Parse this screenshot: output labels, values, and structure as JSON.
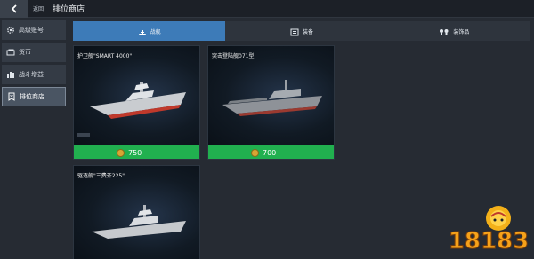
{
  "topbar": {
    "back_label": "返回",
    "title": "排位商店"
  },
  "sidebar": {
    "items": [
      {
        "label": "高级账号",
        "icon": "cog-icon"
      },
      {
        "label": "货币",
        "icon": "cash-icon"
      },
      {
        "label": "战斗增益",
        "icon": "boost-icon"
      },
      {
        "label": "排位商店",
        "icon": "rank-shop-icon",
        "active": true
      }
    ]
  },
  "tabs": [
    {
      "label": "战舰",
      "icon": "warship-icon",
      "active": true
    },
    {
      "label": "装备",
      "icon": "equipment-icon"
    },
    {
      "label": "装饰品",
      "icon": "decoration-icon"
    }
  ],
  "cards": [
    {
      "name": "护卫舰\"SMART 4000\"",
      "price": "750"
    },
    {
      "name": "突击登陆舰071型",
      "price": "700"
    },
    {
      "name": "驱逐舰\"三费齐225\"",
      "price": null
    }
  ],
  "watermark": {
    "text": "18183"
  },
  "colors": {
    "accent": "#3d7bb8",
    "price_bg": "#21b04f",
    "coin": "#d8a534",
    "bg": "#262b33"
  }
}
